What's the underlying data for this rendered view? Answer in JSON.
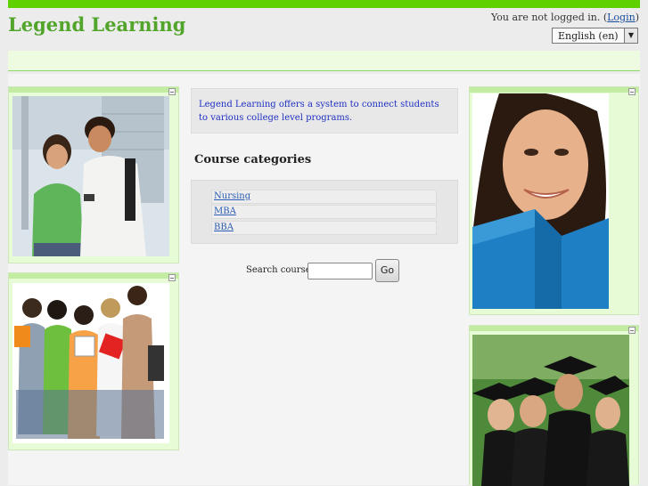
{
  "header": {
    "site_title": "Legend Learning",
    "login_prefix": "You are not logged in. (",
    "login_link": "Login",
    "login_suffix": ")",
    "language": "English (en)"
  },
  "intro": {
    "text": "Legend Learning offers a system to connect students to various college level programs."
  },
  "categories": {
    "heading": "Course categories",
    "items": [
      "Nursing",
      "MBA",
      "BBA"
    ]
  },
  "search": {
    "label": "Search courses:",
    "button": "Go"
  },
  "side_images": {
    "left_top": "students-with-phone-photo",
    "left_bottom": "group-of-students-photo",
    "right_top": "student-reading-book-photo",
    "right_bottom": "graduates-photo"
  },
  "colors": {
    "accent": "#5fd000",
    "title": "#52a52a",
    "block_bg": "#e7fbd6",
    "link": "#2a5bb0"
  }
}
